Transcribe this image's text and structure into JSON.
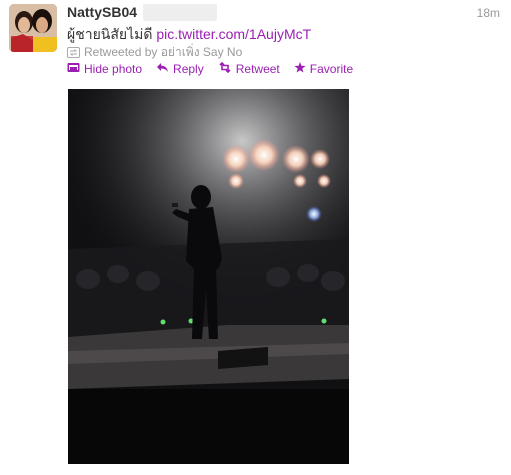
{
  "tweet": {
    "author_name": "NattySB04",
    "timestamp": "18m",
    "text": "ผู้ชายนิสัยไม่ดี",
    "link": "pic.twitter.com/1AujyMcT",
    "retweet_by": "Retweeted by อย่าเพิ่ง Say No"
  },
  "actions": {
    "hide_photo": "Hide photo",
    "reply": "Reply",
    "retweet": "Retweet",
    "favorite": "Favorite"
  },
  "colors": {
    "link": "#9b1fb3",
    "meta": "#999999",
    "text": "#333333"
  }
}
